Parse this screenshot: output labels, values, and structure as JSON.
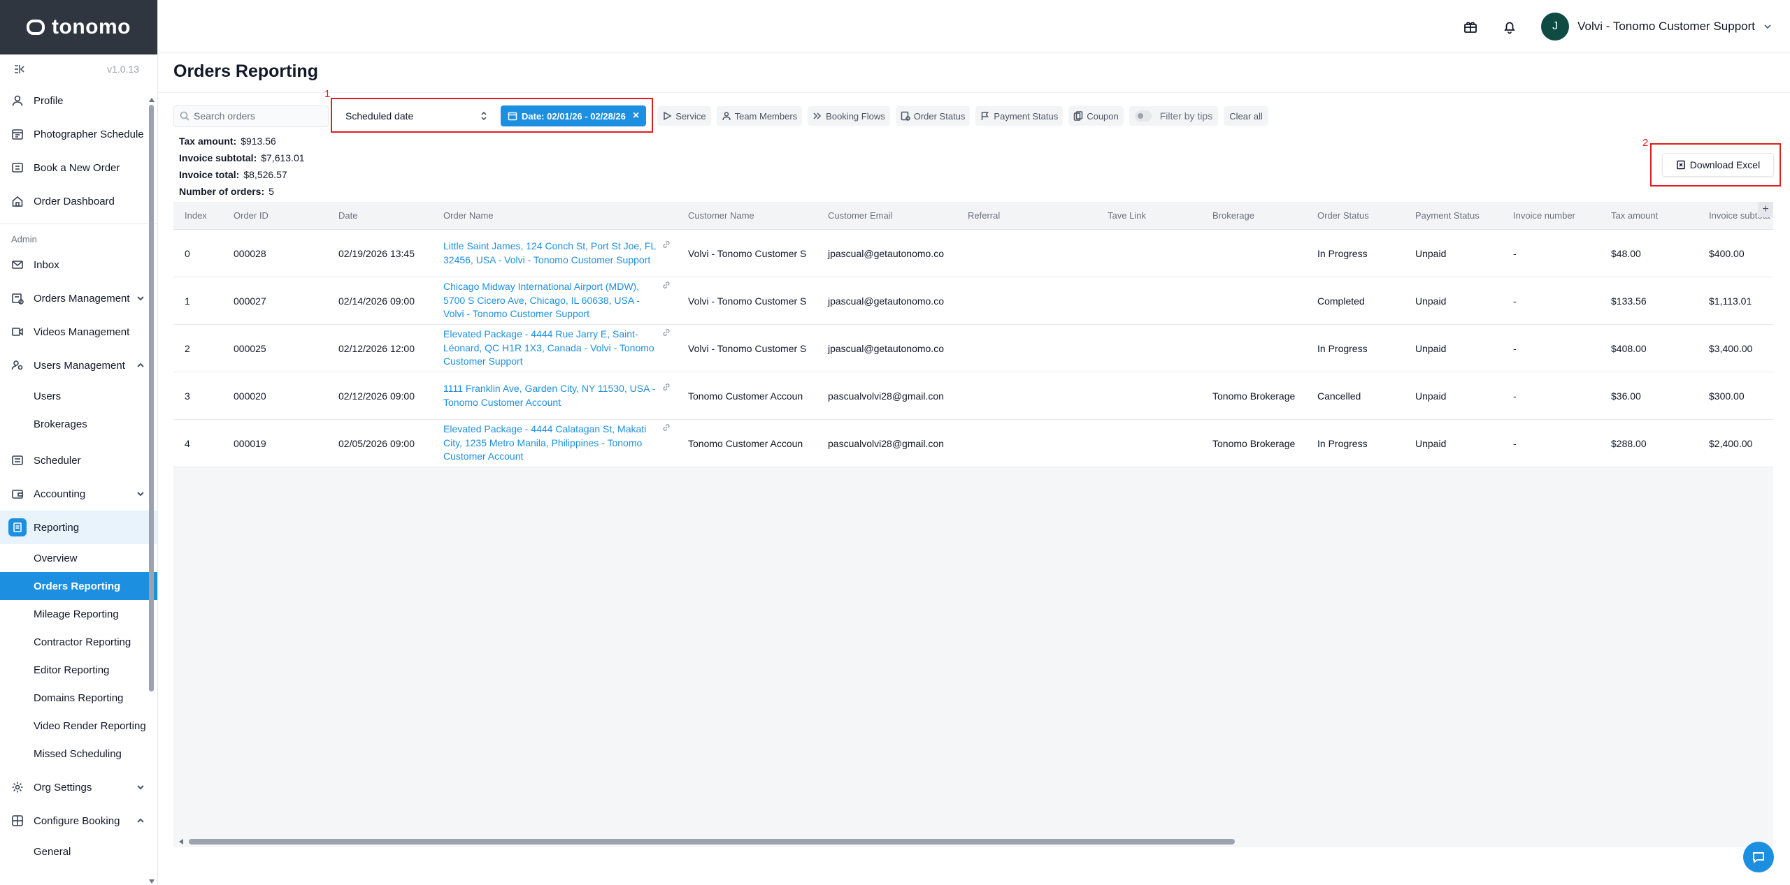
{
  "app": {
    "logo_text": "tonomo",
    "version": "v1.0.13"
  },
  "header": {
    "user_initial": "J",
    "user_name": "Volvi - Tonomo Customer Support"
  },
  "sidebar": {
    "items_top": [
      {
        "label": "Profile",
        "icon": "user-icon"
      },
      {
        "label": "Photographer Schedule",
        "icon": "calendar-icon"
      },
      {
        "label": "Book a New Order",
        "icon": "cart-icon"
      },
      {
        "label": "Order Dashboard",
        "icon": "home-icon"
      }
    ],
    "section_admin": "Admin",
    "inbox": "Inbox",
    "orders_management": "Orders Management",
    "videos_management": "Videos Management",
    "users_management": "Users Management",
    "users_sub": [
      "Users",
      "Brokerages"
    ],
    "scheduler": "Scheduler",
    "accounting": "Accounting",
    "reporting": "Reporting",
    "reporting_sub": [
      "Overview",
      "Orders Reporting",
      "Mileage Reporting",
      "Contractor Reporting",
      "Editor Reporting",
      "Domains Reporting",
      "Video Render Reporting",
      "Missed Scheduling"
    ],
    "org_settings": "Org Settings",
    "configure_booking": "Configure Booking",
    "configure_sub": [
      "General"
    ]
  },
  "page": {
    "title": "Orders Reporting"
  },
  "filters": {
    "search_placeholder": "Search orders",
    "date_type": "Scheduled date",
    "date_chip": "Date: 02/01/26 - 02/28/26",
    "chips": [
      "Service",
      "Team Members",
      "Booking Flows",
      "Order Status",
      "Payment Status",
      "Coupon"
    ],
    "tips_label": "Filter by tips",
    "clear_all": "Clear all"
  },
  "annotations": {
    "label1": "1",
    "label2": "2"
  },
  "summary": {
    "tax_amount_label": "Tax amount:",
    "tax_amount": "$913.56",
    "invoice_subtotal_label": "Invoice subtotal:",
    "invoice_subtotal": "$7,613.01",
    "invoice_total_label": "Invoice total:",
    "invoice_total": "$8,526.57",
    "orders_label": "Number of orders:",
    "orders": "5"
  },
  "download_label": "Download Excel",
  "table": {
    "columns": [
      "Index",
      "Order ID",
      "Date",
      "Order Name",
      "Customer Name",
      "Customer Email",
      "Referral",
      "Tave Link",
      "Brokerage",
      "Order Status",
      "Payment Status",
      "Invoice number",
      "Tax amount",
      "Invoice subtota"
    ],
    "rows": [
      [
        "0",
        "000028",
        "02/19/2026 13:45",
        "Little Saint James, 124 Conch St, Port St Joe, FL 32456, USA - Volvi - Tonomo Customer Support",
        "Volvi - Tonomo Customer S",
        "jpascual@getautonomo.co",
        "",
        "",
        "",
        "In Progress",
        "Unpaid",
        "-",
        "$48.00",
        "$400.00"
      ],
      [
        "1",
        "000027",
        "02/14/2026 09:00",
        "Chicago Midway International Airport (MDW), 5700 S Cicero Ave, Chicago, IL 60638, USA - Volvi - Tonomo Customer Support",
        "Volvi - Tonomo Customer S",
        "jpascual@getautonomo.co",
        "",
        "",
        "",
        "Completed",
        "Unpaid",
        "-",
        "$133.56",
        "$1,113.01"
      ],
      [
        "2",
        "000025",
        "02/12/2026 12:00",
        "Elevated Package - 4444 Rue Jarry E, Saint-Léonard, QC H1R 1X3, Canada - Volvi - Tonomo Customer Support",
        "Volvi - Tonomo Customer S",
        "jpascual@getautonomo.co",
        "",
        "",
        "",
        "In Progress",
        "Unpaid",
        "-",
        "$408.00",
        "$3,400.00"
      ],
      [
        "3",
        "000020",
        "02/12/2026 09:00",
        "1111 Franklin Ave, Garden City, NY 11530, USA - Tonomo Customer Account",
        "Tonomo Customer Accoun",
        "pascualvolvi28@gmail.con",
        "",
        "",
        "Tonomo Brokerage",
        "Cancelled",
        "Unpaid",
        "-",
        "$36.00",
        "$300.00"
      ],
      [
        "4",
        "000019",
        "02/05/2026 09:00",
        "Elevated Package - 4444 Calatagan St, Makati City, 1235 Metro Manila, Philippines - Tonomo Customer Account",
        "Tonomo Customer Accoun",
        "pascualvolvi28@gmail.con",
        "",
        "",
        "Tonomo Brokerage",
        "In Progress",
        "Unpaid",
        "-",
        "$288.00",
        "$2,400.00"
      ]
    ]
  },
  "colors": {
    "accent": "#1d8fe1",
    "brand_dark": "#2f3640",
    "annotation_red": "#e11d1d",
    "avatar": "#0f4a43"
  }
}
